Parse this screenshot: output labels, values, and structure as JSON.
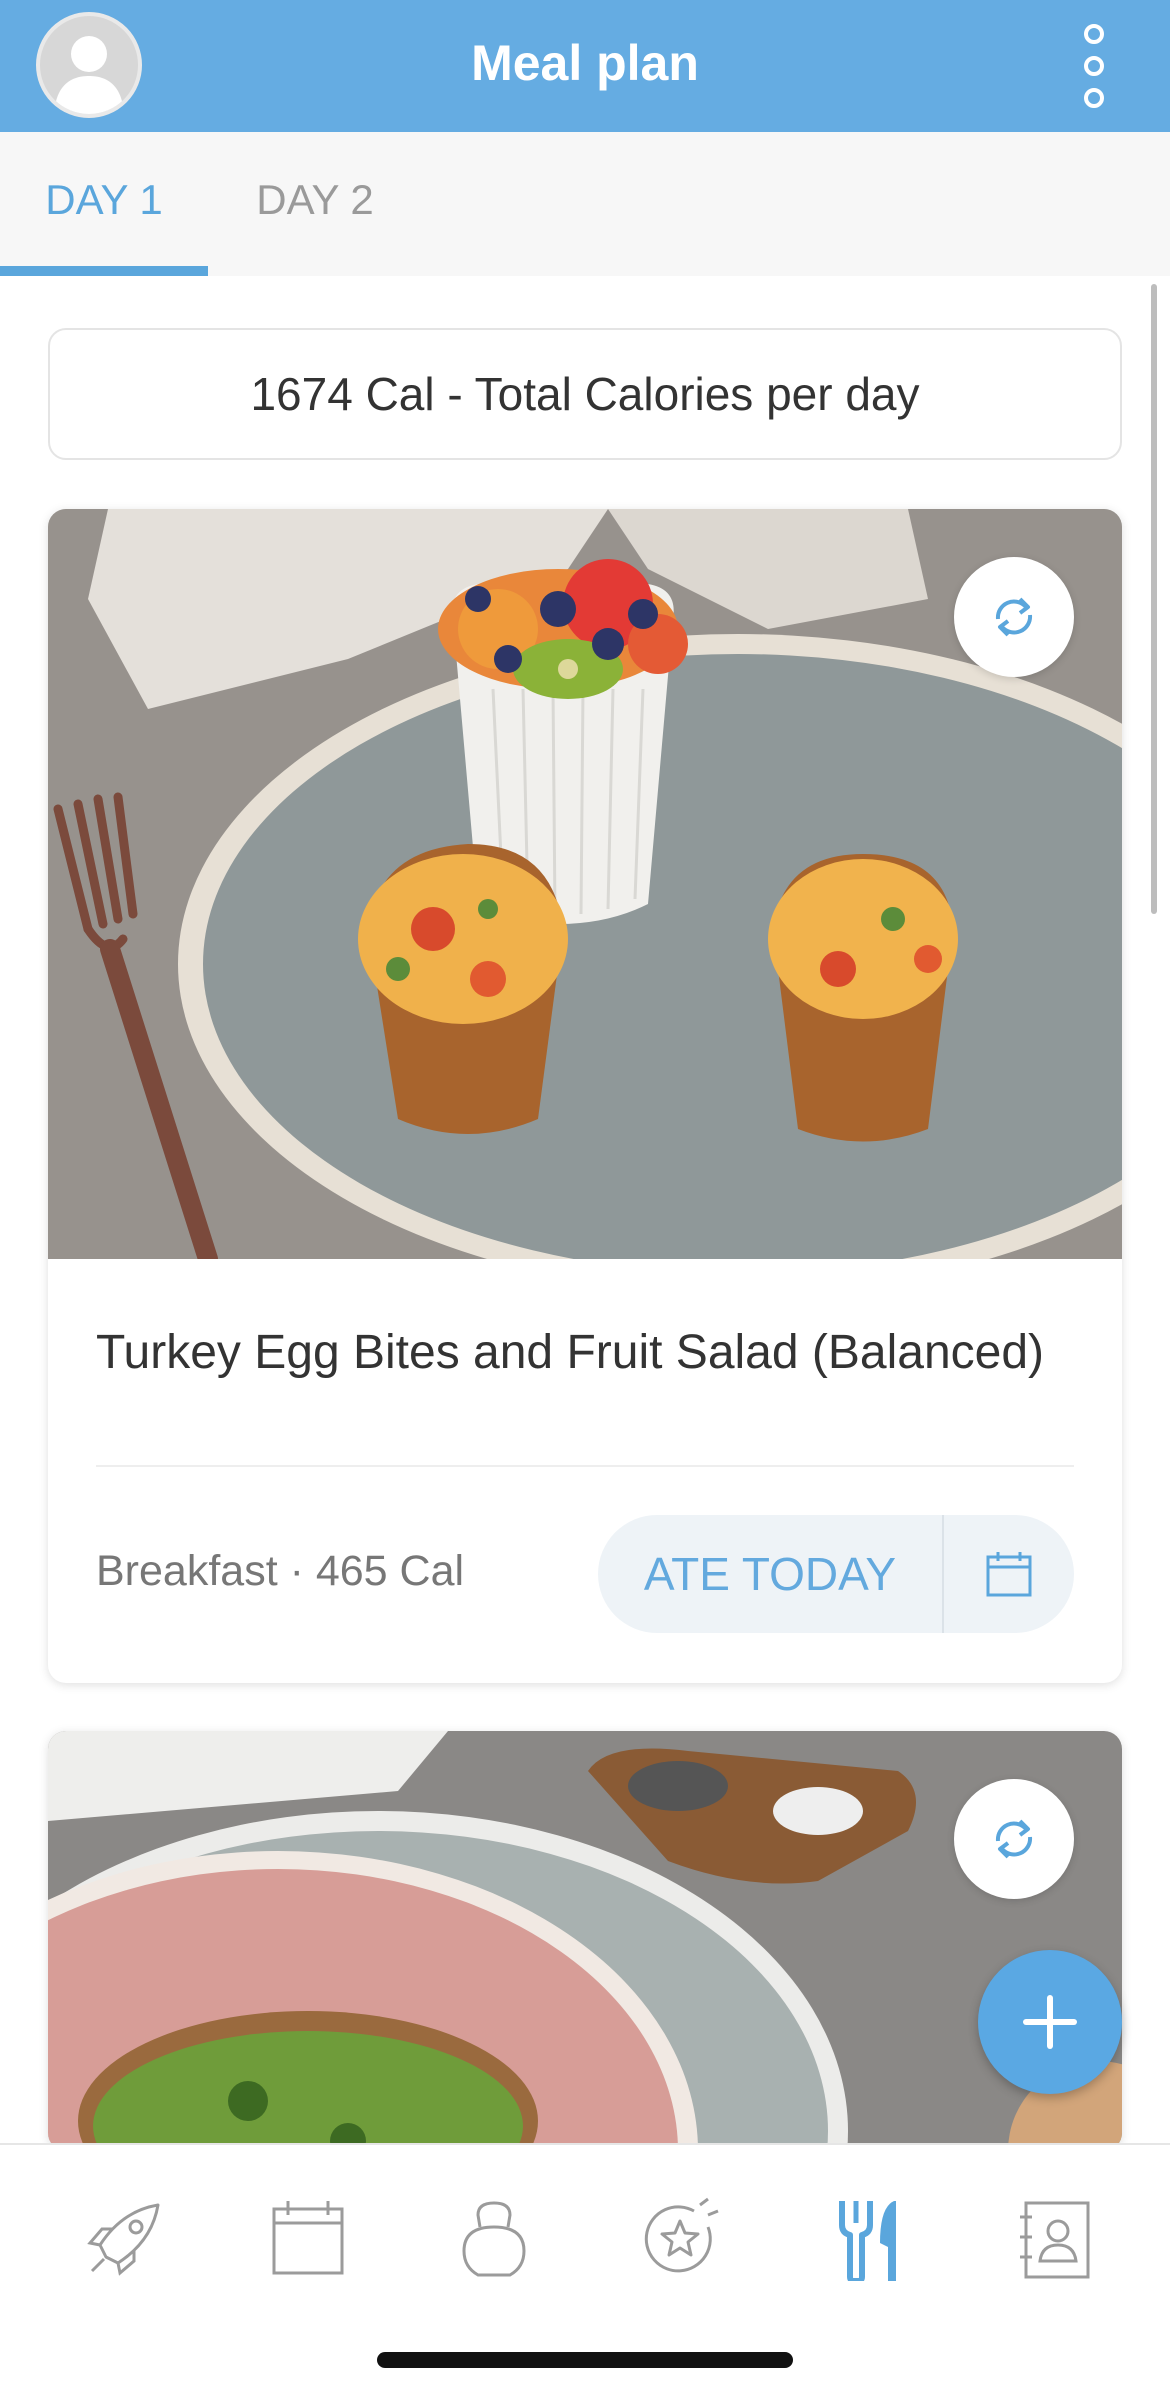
{
  "header": {
    "title": "Meal plan"
  },
  "tabs": [
    {
      "label": "DAY 1",
      "selected": true
    },
    {
      "label": "DAY 2",
      "selected": false
    }
  ],
  "summary": {
    "calories_text": "1674 Cal - Total Calories per day"
  },
  "meals": [
    {
      "title": "Turkey Egg Bites and Fruit Salad (Balanced)",
      "meta": "Breakfast · 465 Cal",
      "ate_label": "ATE TODAY"
    }
  ],
  "bottom_nav": {
    "items": [
      "rocket-icon",
      "calendar-icon",
      "kettlebell-icon",
      "star-badge-icon",
      "fork-knife-icon",
      "contacts-icon"
    ],
    "active": "fork-knife-icon"
  },
  "colors": {
    "accent": "#5aa6dc",
    "header": "#65ace2",
    "ate_bg": "#eef3f7"
  }
}
